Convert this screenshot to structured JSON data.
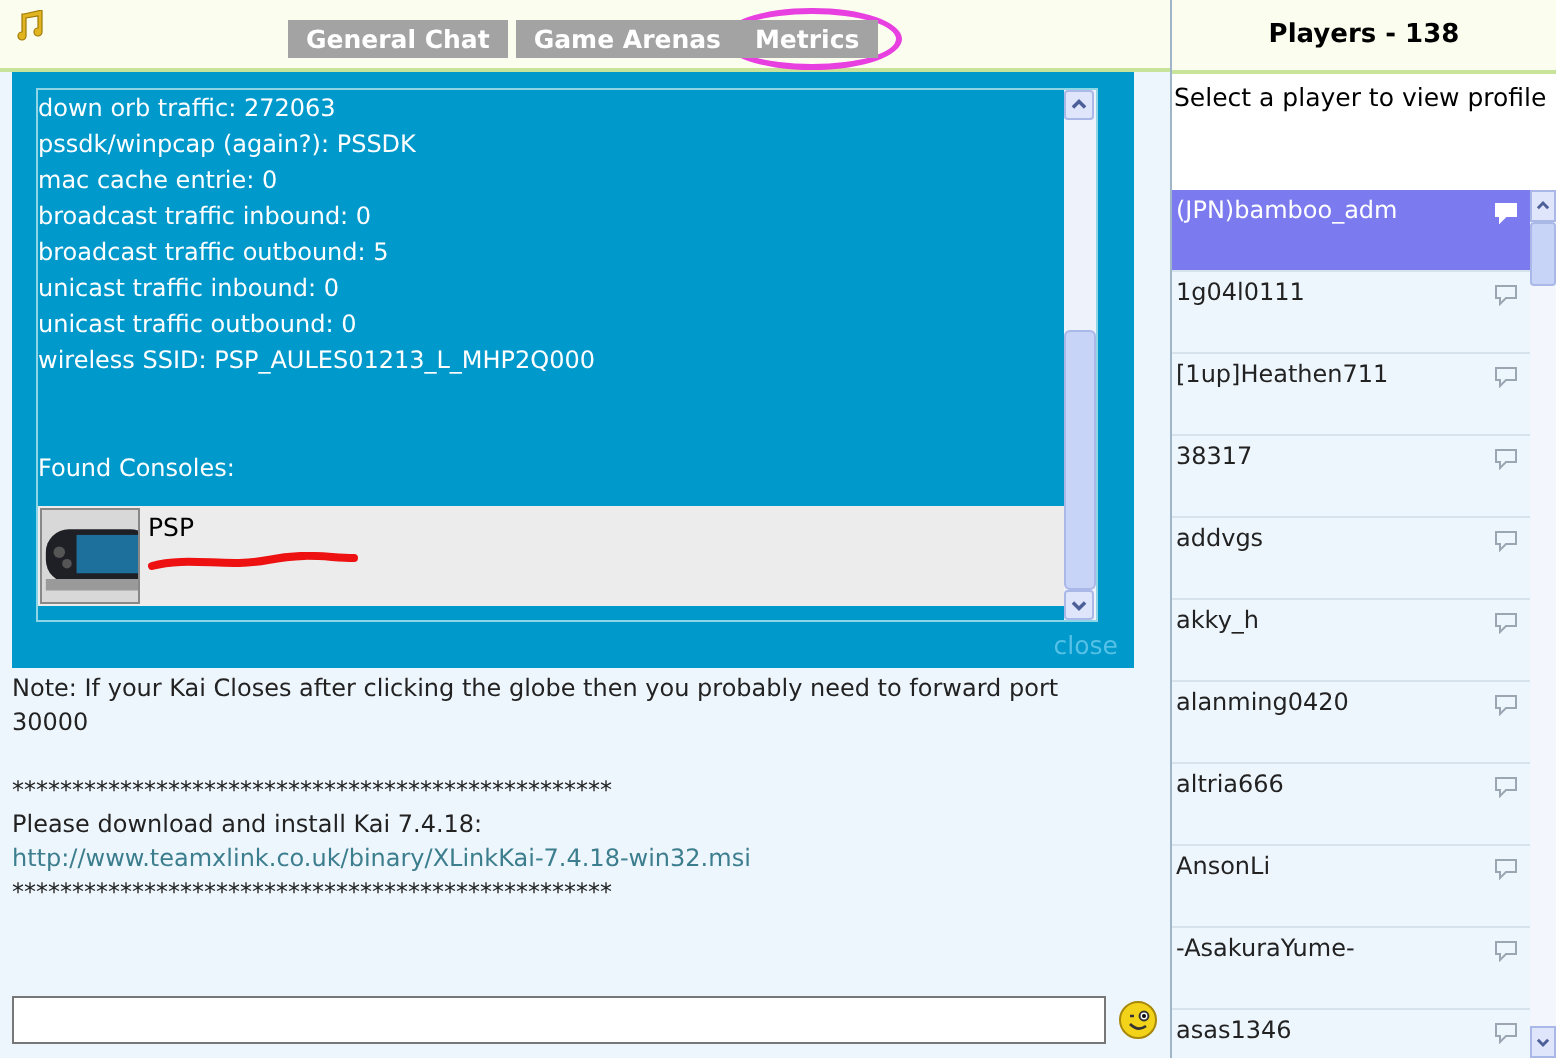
{
  "header": {
    "tabs": [
      {
        "label": "General Chat",
        "circled": false
      },
      {
        "label": "Game Arenas",
        "circled": false
      },
      {
        "label": "Metrics",
        "circled": true
      }
    ]
  },
  "metrics_popup": {
    "lines": [
      "down orb traffic: 272063",
      "pssdk/winpcap (again?): PSSDK",
      "mac cache entrie: 0",
      "broadcast traffic inbound: 0",
      "broadcast traffic outbound: 5",
      "unicast traffic inbound: 0",
      "unicast traffic outbound: 0",
      "wireless SSID: PSP_AULES01213_L_MHP2Q000"
    ],
    "found_label": "Found Consoles:",
    "consoles": [
      {
        "name": "PSP",
        "kind": "picture",
        "redacted": true
      }
    ],
    "close": "close"
  },
  "chat": {
    "messages": [
      {
        "kind": "text",
        "text": "Note: If your Kai Closes after clicking the globe then you probably need to forward port 30000"
      },
      {
        "kind": "rule",
        "text": "**************************************************"
      },
      {
        "kind": "text",
        "text": "Please download and install Kai 7.4.18:"
      },
      {
        "kind": "link",
        "text": "http://www.teamxlink.co.uk/binary/XLinkKai-7.4.18-win32.msi"
      },
      {
        "kind": "rule",
        "text": "**************************************************"
      }
    ]
  },
  "players": {
    "title": "Players - 138",
    "hint": "Select a player to view profile",
    "items": [
      {
        "name": "(JPN)bamboo_adm",
        "selected": true
      },
      {
        "name": "1g04l0111",
        "selected": false
      },
      {
        "name": "[1up]Heathen711",
        "selected": false
      },
      {
        "name": "38317",
        "selected": false
      },
      {
        "name": "addvgs",
        "selected": false
      },
      {
        "name": "akky_h",
        "selected": false
      },
      {
        "name": "alanming0420",
        "selected": false
      },
      {
        "name": "altria666",
        "selected": false
      },
      {
        "name": "AnsonLi",
        "selected": false
      },
      {
        "name": "-AsakuraYume-",
        "selected": false
      },
      {
        "name": "asas1346",
        "selected": false
      }
    ]
  }
}
